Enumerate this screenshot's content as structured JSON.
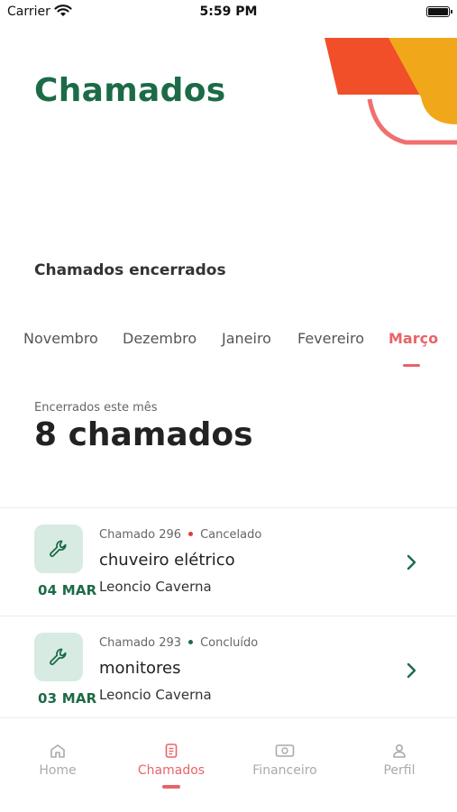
{
  "status": {
    "carrier": "Carrier",
    "time": "5:59 PM"
  },
  "page": {
    "title": "Chamados",
    "section_title": "Chamados encerrados"
  },
  "months": [
    {
      "label": "Novembro",
      "active": false
    },
    {
      "label": "Dezembro",
      "active": false
    },
    {
      "label": "Janeiro",
      "active": false
    },
    {
      "label": "Fevereiro",
      "active": false
    },
    {
      "label": "Março",
      "active": true
    }
  ],
  "summary": {
    "label": "Encerrados este mês",
    "count": "8 chamados"
  },
  "tickets": [
    {
      "number": "Chamado 296",
      "status": "Cancelado",
      "status_color": "#e03a3a",
      "name": "chuveiro elétrico",
      "person": "Leoncio Caverna",
      "date": "04 MAR"
    },
    {
      "number": "Chamado 293",
      "status": "Concluído",
      "status_color": "#1c6b47",
      "name": "monitores",
      "person": "Leoncio Caverna",
      "date": "03 MAR"
    }
  ],
  "nav": [
    {
      "label": "Home",
      "icon": "home-icon",
      "active": false
    },
    {
      "label": "Chamados",
      "icon": "document-icon",
      "active": true
    },
    {
      "label": "Financeiro",
      "icon": "money-icon",
      "active": false
    },
    {
      "label": "Perfil",
      "icon": "user-icon",
      "active": false
    }
  ],
  "colors": {
    "brand_green": "#1c6b47",
    "accent_red": "#e8646a",
    "deco_orange": "#f04f2a",
    "deco_yellow": "#f0a81a"
  }
}
